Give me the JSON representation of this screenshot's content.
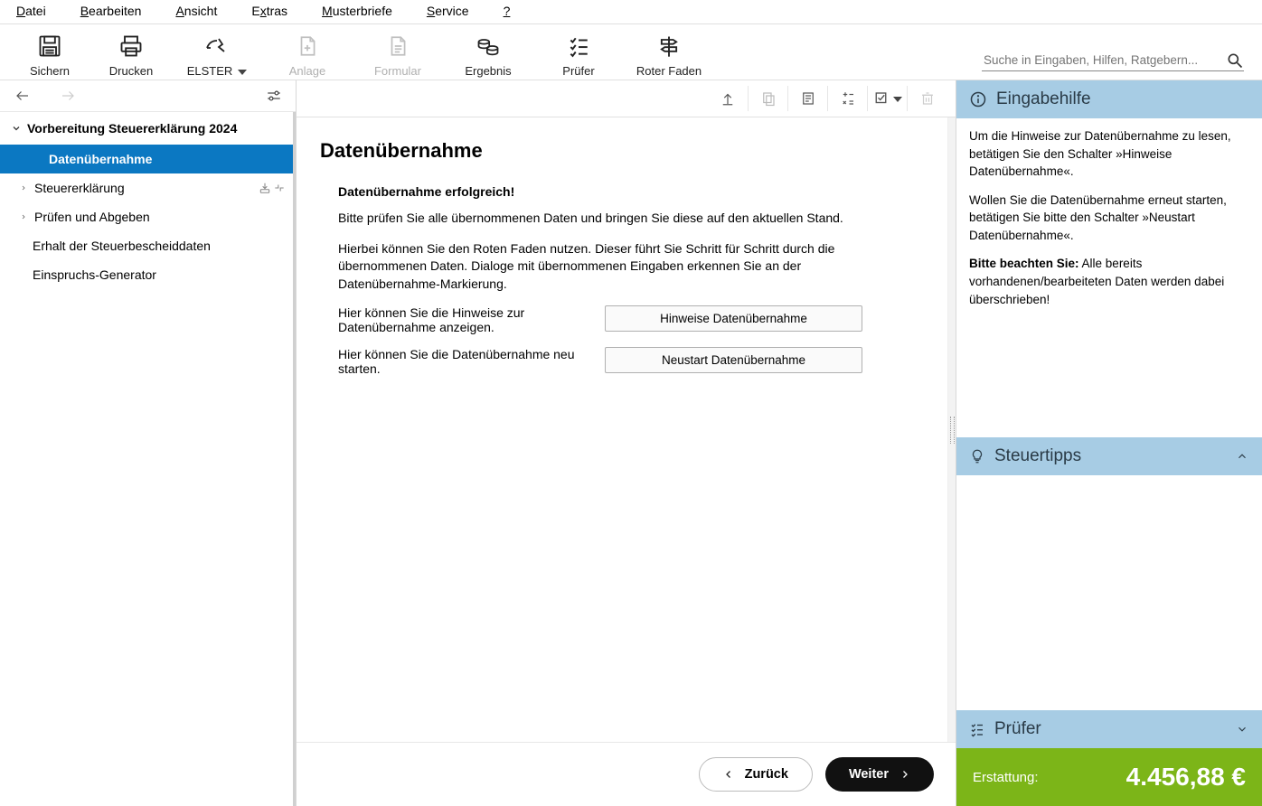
{
  "menu": {
    "items": [
      "Datei",
      "Bearbeiten",
      "Ansicht",
      "Extras",
      "Musterbriefe",
      "Service",
      "?"
    ]
  },
  "toolbar": {
    "save": "Sichern",
    "print": "Drucken",
    "elster": "ELSTER",
    "anlage": "Anlage",
    "formular": "Formular",
    "ergebnis": "Ergebnis",
    "pruefer": "Prüfer",
    "roter_faden": "Roter Faden",
    "search_placeholder": "Suche in Eingaben, Hilfen, Ratgebern..."
  },
  "sidebar": {
    "root": "Vorbereitung Steuererklärung 2024",
    "items": [
      "Datenübernahme",
      "Steuererklärung",
      "Prüfen und Abgeben",
      "Erhalt der Steuerbescheiddaten",
      "Einspruchs-Generator"
    ]
  },
  "main": {
    "title": "Datenübernahme",
    "success": "Datenübernahme erfolgreich!",
    "p1": "Bitte prüfen Sie alle übernommenen Daten und bringen Sie diese auf den aktuellen Stand.",
    "p2": "Hierbei können Sie den Roten Faden nutzen. Dieser führt Sie Schritt für Schritt durch die übernommenen Daten. Dialoge mit übernommenen Eingaben erkennen Sie an der Datenübernahme-Markierung.",
    "hint_text": "Hier können Sie die Hinweise zur Datenübernahme anzeigen.",
    "hint_button": "Hinweise Datenübernahme",
    "restart_text": "Hier können Sie die Datenübernahme neu starten.",
    "restart_button": "Neustart Datenübernahme",
    "back": "Zurück",
    "next": "Weiter"
  },
  "help": {
    "title": "Eingabehilfe",
    "p1": "Um die Hinweise zur Datenübernahme zu lesen, betätigen Sie den Schalter »Hinweise Datenübernahme«.",
    "p2": "Wollen Sie die Datenübernahme erneut starten, betätigen Sie bitte den Schalter »Neustart Datenübernahme«.",
    "p3_bold": "Bitte beachten Sie:",
    "p3_rest": " Alle bereits vorhandenen/bearbeiteten Daten werden dabei überschrieben!"
  },
  "tips": {
    "title": "Steuertipps"
  },
  "checker": {
    "title": "Prüfer"
  },
  "refund": {
    "label": "Erstattung:",
    "value": "4.456,88 €"
  }
}
